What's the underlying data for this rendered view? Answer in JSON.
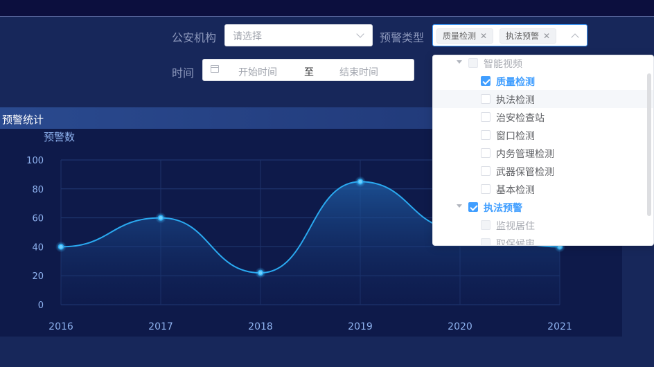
{
  "filters": {
    "agency_label": "公安机构",
    "agency_placeholder": "请选择",
    "warning_type_label": "预警类型",
    "warning_type_tags": [
      "质量检测",
      "执法预警"
    ],
    "time_label": "时间",
    "start_placeholder": "开始时间",
    "range_separator": "至",
    "end_placeholder": "结束时间"
  },
  "section": {
    "title": "预警统计"
  },
  "tree_dropdown": {
    "nodes": [
      {
        "label": "智能视频",
        "level": 0,
        "expanded": true,
        "checked": false,
        "disabled": true
      },
      {
        "label": "质量检测",
        "level": 1,
        "checked": true
      },
      {
        "label": "执法检测",
        "level": 1,
        "checked": false,
        "hover": true
      },
      {
        "label": "治安检查站",
        "level": 1,
        "checked": false
      },
      {
        "label": "窗口检测",
        "level": 1,
        "checked": false
      },
      {
        "label": "内务管理检测",
        "level": 1,
        "checked": false
      },
      {
        "label": "武器保管检测",
        "level": 1,
        "checked": false
      },
      {
        "label": "基本检测",
        "level": 1,
        "checked": false
      },
      {
        "label": "执法预警",
        "level": 0,
        "expanded": true,
        "checked": true
      },
      {
        "label": "监视居住",
        "level": 1,
        "checked": false,
        "disabled": true
      },
      {
        "label": "取保候审",
        "level": 1,
        "checked": false,
        "disabled": true
      }
    ]
  },
  "chart_data": {
    "type": "line",
    "title": "",
    "ylabel": "预警数",
    "xlabel": "",
    "categories": [
      "2016",
      "2017",
      "2018",
      "2019",
      "2020",
      "2021"
    ],
    "series": [
      {
        "values": [
          40,
          60,
          22,
          85,
          52,
          40
        ]
      }
    ],
    "ylim": [
      0,
      100
    ],
    "yticks": [
      0,
      20,
      40,
      60,
      80,
      100
    ],
    "smooth": true,
    "area_fill": true,
    "grid": true,
    "line_color": "#2aa9f0"
  }
}
